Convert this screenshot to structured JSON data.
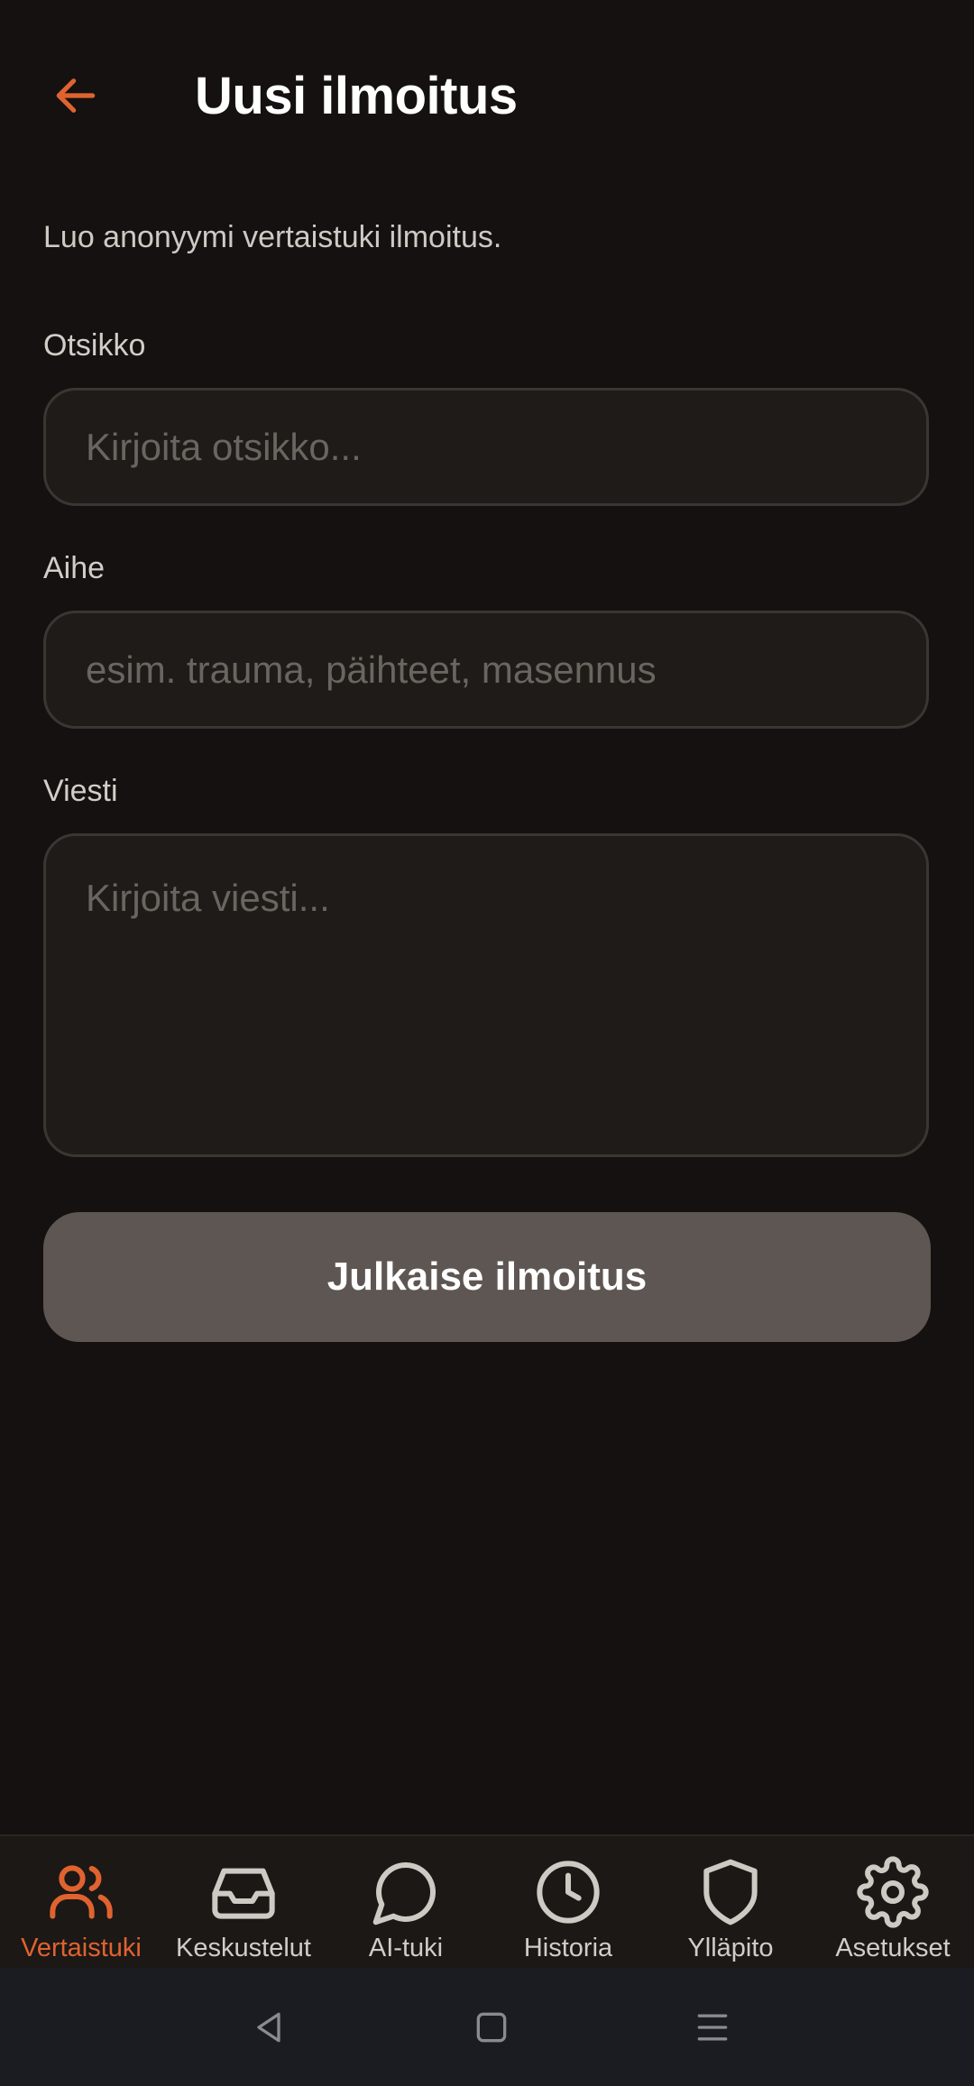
{
  "header": {
    "title": "Uusi ilmoitus",
    "back_icon": "arrow-left-icon"
  },
  "form": {
    "intro": "Luo anonyymi vertaistuki ilmoitus.",
    "title_label": "Otsikko",
    "title_placeholder": "Kirjoita otsikko...",
    "title_value": "",
    "topic_label": "Aihe",
    "topic_placeholder": "esim. trauma, päihteet, masennus",
    "topic_value": "",
    "message_label": "Viesti",
    "message_placeholder": "Kirjoita viesti...",
    "message_value": "",
    "submit_label": "Julkaise ilmoitus"
  },
  "nav": {
    "active": "Vertaistuki",
    "items": [
      {
        "label": "Vertaistuki",
        "icon": "users-icon"
      },
      {
        "label": "Keskustelut",
        "icon": "inbox-icon"
      },
      {
        "label": "AI-tuki",
        "icon": "chat-bubble-icon"
      },
      {
        "label": "Historia",
        "icon": "clock-icon"
      },
      {
        "label": "Ylläpito",
        "icon": "shield-icon"
      },
      {
        "label": "Asetukset",
        "icon": "gear-icon"
      }
    ]
  },
  "colors": {
    "accent": "#e0632f",
    "background": "#141110",
    "button": "#5e5652",
    "input_bg": "#1e1b18",
    "input_border": "#3a3631"
  }
}
